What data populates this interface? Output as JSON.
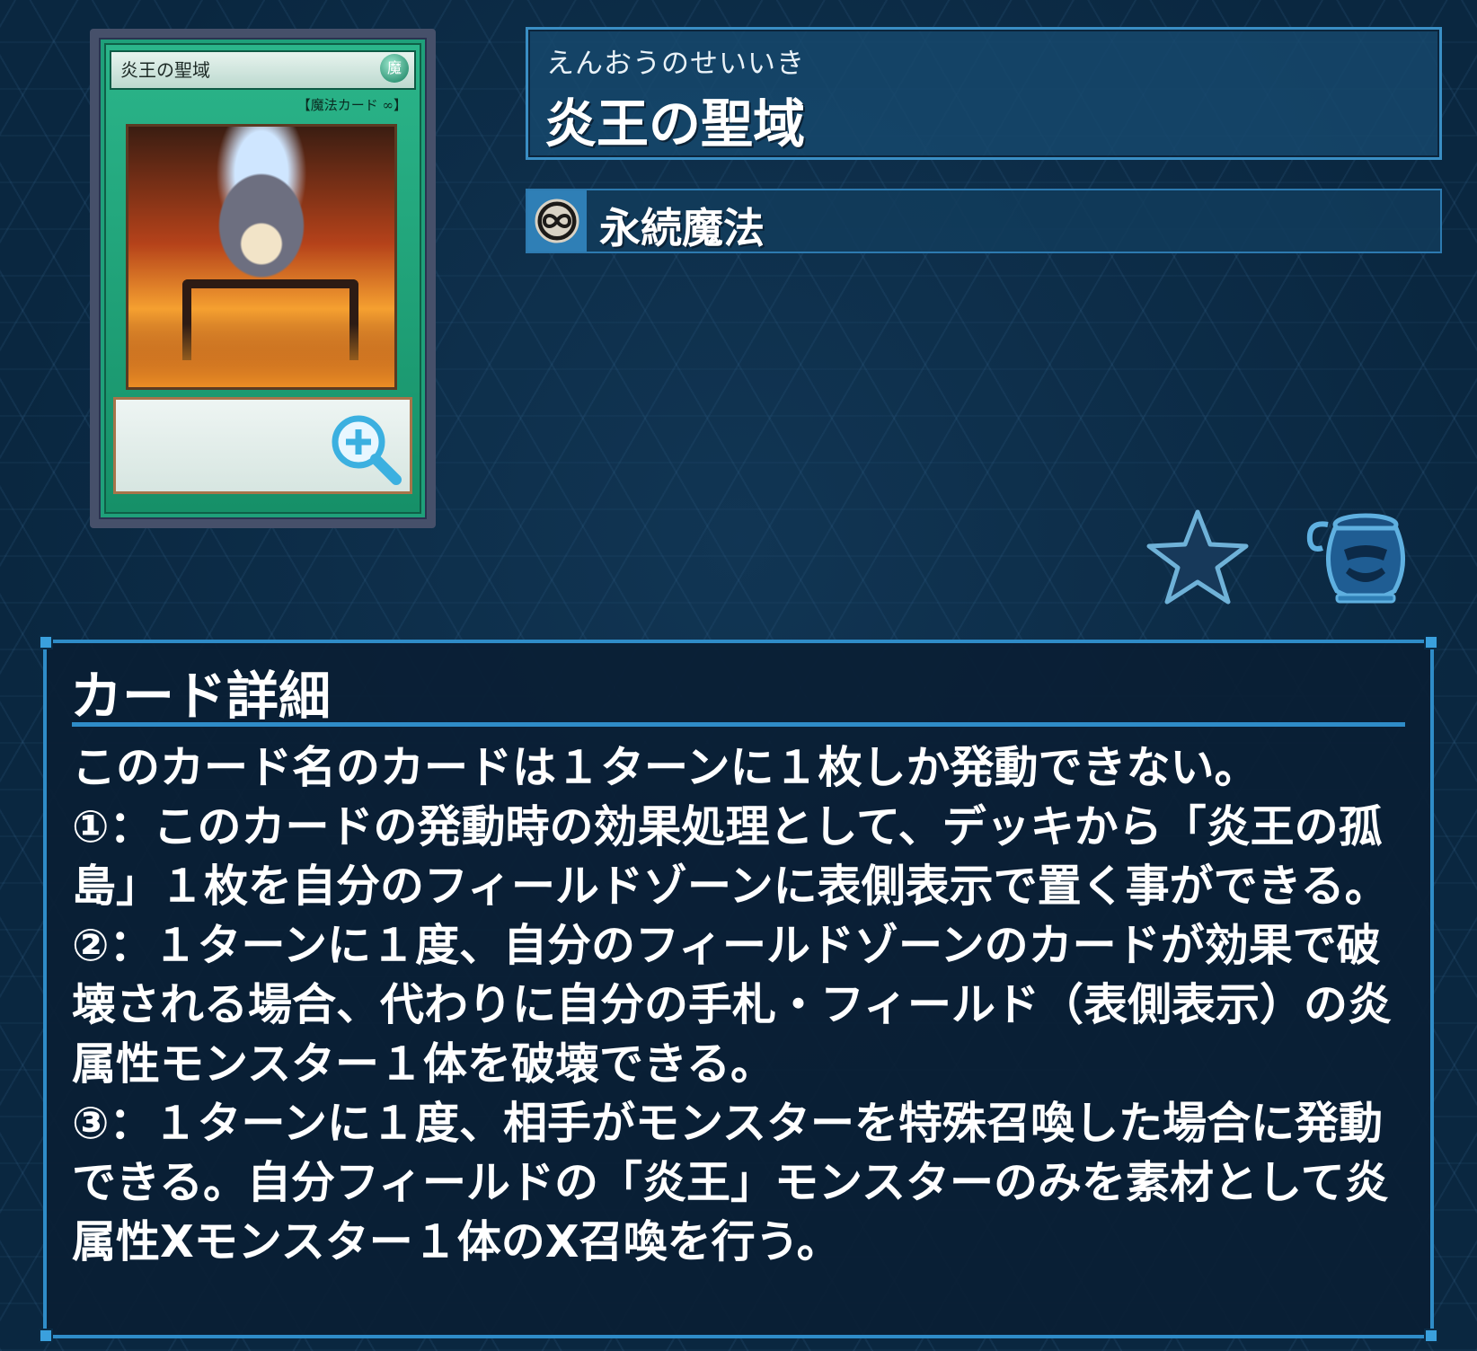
{
  "card": {
    "image_name": "炎王の聖域",
    "image_attribute": "魔",
    "image_type_line": "【魔法カード ∞】"
  },
  "header": {
    "ruby": "えんおうのせいいき",
    "title": "炎王の聖域"
  },
  "type": {
    "icon": "continuous-infinity-icon",
    "label": "永続魔法"
  },
  "actions": {
    "favorite_icon": "star-icon",
    "pot_icon": "pot-of-greed-icon"
  },
  "details": {
    "heading": "カード詳細",
    "text": "このカード名のカードは１ターンに１枚しか発動できない。\n①：このカードの発動時の効果処理として、デッキから「炎王の孤島」１枚を自分のフィールドゾーンに表側表示で置く事ができる。\n②：１ターンに１度、自分のフィールドゾーンのカードが効果で破壊される場合、代わりに自分の手札・フィールド（表側表示）の炎属性モンスター１体を破壊できる。\n③：１ターンに１度、相手がモンスターを特殊召喚した場合に発動できる。自分フィールドの「炎王」モンスターのみを素材として炎属性Xモンスター１体のX召喚を行う。"
  },
  "colors": {
    "background": "#0a2740",
    "panel_border": "#2f8cc8",
    "card_frame": "#1fa07a"
  }
}
